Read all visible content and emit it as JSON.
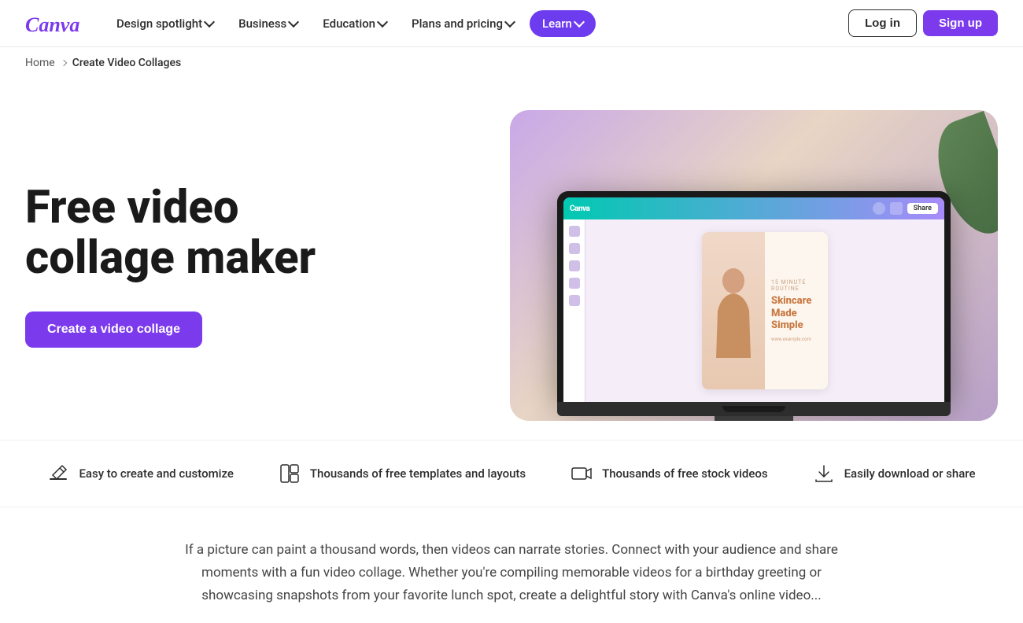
{
  "brand": {
    "name": "Canva",
    "color": "#7c3aed"
  },
  "nav": {
    "items": [
      {
        "id": "design-spotlight",
        "label": "Design spotlight",
        "hasDropdown": true
      },
      {
        "id": "business",
        "label": "Business",
        "hasDropdown": true
      },
      {
        "id": "education",
        "label": "Education",
        "hasDropdown": true
      },
      {
        "id": "plans-pricing",
        "label": "Plans and pricing",
        "hasDropdown": true
      },
      {
        "id": "learn",
        "label": "Learn",
        "hasDropdown": true,
        "active": true
      }
    ],
    "login_label": "Log in",
    "signup_label": "Sign up"
  },
  "breadcrumb": {
    "home": "Home",
    "current": "Create Video Collages"
  },
  "hero": {
    "title": "Free video collage maker",
    "cta_label": "Create a video collage"
  },
  "features": [
    {
      "id": "easy-create",
      "icon": "edit-icon",
      "text": "Easy to create and customize"
    },
    {
      "id": "templates",
      "icon": "grid-icon",
      "text": "Thousands of free templates and layouts"
    },
    {
      "id": "stock",
      "icon": "video-icon",
      "text": "Thousands of free stock videos"
    },
    {
      "id": "download",
      "icon": "download-icon",
      "text": "Easily download or share"
    }
  ],
  "description": {
    "text": "If a picture can paint a thousand words, then videos can narrate stories. Connect with your audience and share moments with a fun video collage. Whether you're compiling memorable videos for a birthday greeting or showcasing snapshots from your favorite lunch spot, create a delightful story with Canva's online video..."
  },
  "canvas_card": {
    "subtitle": "15 minute routine",
    "title": "Skincare Made Simple",
    "note": "www.example.com"
  }
}
